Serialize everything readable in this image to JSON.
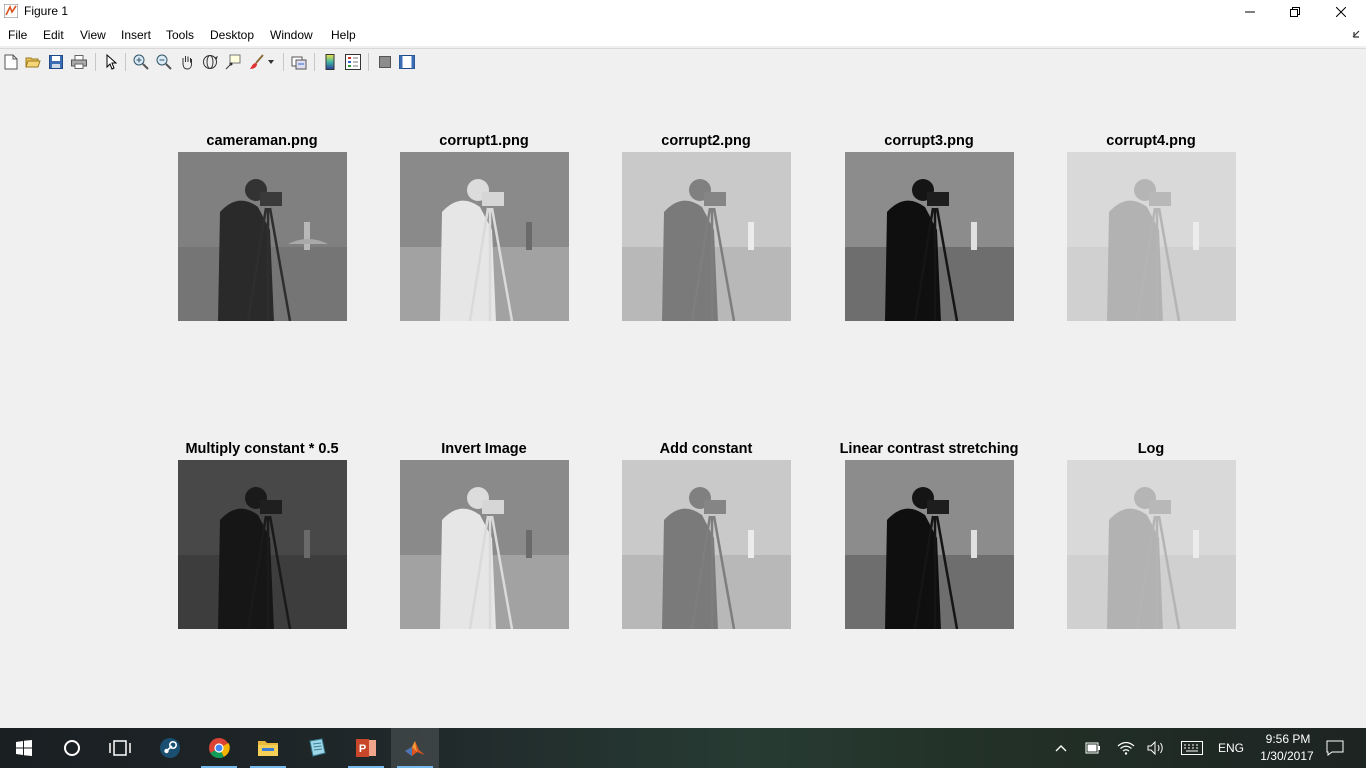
{
  "window": {
    "title": "Figure 1",
    "minimize_icon": "minimize-icon",
    "restore_icon": "restore-icon",
    "close_icon": "close-icon"
  },
  "menu": {
    "items": [
      "File",
      "Edit",
      "View",
      "Insert",
      "Tools",
      "Desktop",
      "Window",
      "Help"
    ]
  },
  "toolbar": {
    "icons": [
      "new-figure-icon",
      "open-file-icon",
      "save-icon",
      "print-icon",
      "edit-plot-icon",
      "zoom-in-icon",
      "zoom-out-icon",
      "pan-icon",
      "rotate-3d-icon",
      "data-cursor-icon",
      "brush-icon",
      "link-plot-icon",
      "colorbar-icon",
      "legend-icon",
      "hide-plot-tools-icon",
      "show-plot-tools-icon"
    ]
  },
  "figure": {
    "panels": [
      {
        "title": "cameraman.png",
        "brightness": "normal"
      },
      {
        "title": "corrupt1.png",
        "brightness": "inverted"
      },
      {
        "title": "corrupt2.png",
        "brightness": "bright"
      },
      {
        "title": "corrupt3.png",
        "brightness": "high-contrast"
      },
      {
        "title": "corrupt4.png",
        "brightness": "washed-out"
      },
      {
        "title": "Multiply constant * 0.5",
        "brightness": "dark"
      },
      {
        "title": "Invert Image",
        "brightness": "inverted"
      },
      {
        "title": "Add constant",
        "brightness": "bright"
      },
      {
        "title": "Linear contrast stretching",
        "brightness": "high-contrast"
      },
      {
        "title": "Log",
        "brightness": "washed-out"
      }
    ]
  },
  "taskbar": {
    "apps": [
      "start-icon",
      "cortana-icon",
      "task-view-icon",
      "steam-icon",
      "chrome-icon",
      "file-explorer-icon",
      "notepad-icon",
      "powerpoint-icon",
      "matlab-icon"
    ],
    "tray": {
      "language": "ENG",
      "time": "9:56 PM",
      "date": "1/30/2017"
    }
  },
  "colors": {
    "taskbar_active": "#76b9ed",
    "figure_background": "#f0f0f0"
  }
}
